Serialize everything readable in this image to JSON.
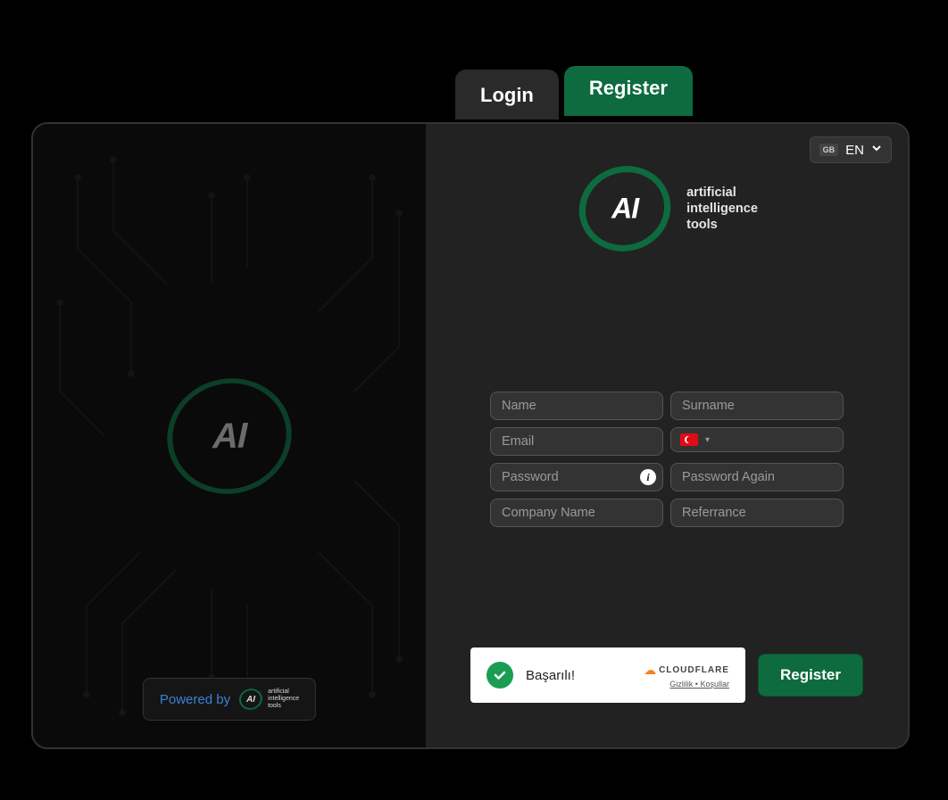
{
  "tabs": {
    "login": "Login",
    "register": "Register"
  },
  "lang": {
    "badge": "GB",
    "code": "EN"
  },
  "logo": {
    "mark": "AI",
    "tag_line1": "artificial",
    "tag_line2": "intelligence",
    "tag_line3": "tools"
  },
  "powered": {
    "text": "Powered by",
    "mark": "AI",
    "tag_line1": "artificial",
    "tag_line2": "intelligence",
    "tag_line3": "tools"
  },
  "form": {
    "name_ph": "Name",
    "surname_ph": "Surname",
    "email_ph": "Email",
    "password_ph": "Password",
    "password_again_ph": "Password Again",
    "company_ph": "Company Name",
    "referrance_ph": "Referrance"
  },
  "captcha": {
    "success": "Başarılı!",
    "brand": "CLOUDFLARE",
    "privacy": "Gizlilik",
    "sep": " • ",
    "terms": "Koşullar"
  },
  "buttons": {
    "register": "Register"
  },
  "colors": {
    "accent": "#0d6b3f"
  }
}
